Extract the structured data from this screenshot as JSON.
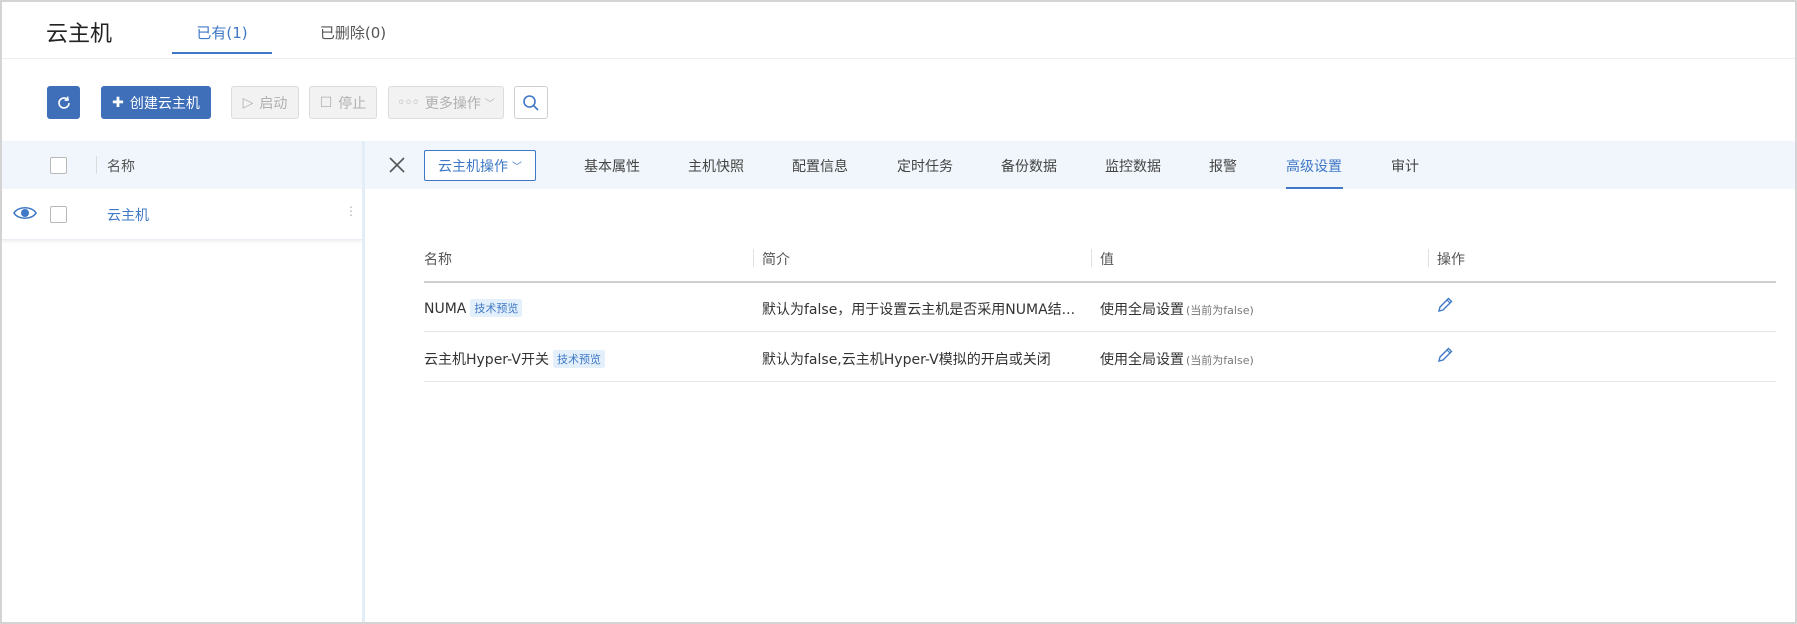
{
  "header": {
    "title": "云主机",
    "tabs": [
      {
        "label": "已有(1)",
        "active": true
      },
      {
        "label": "已删除(0)",
        "active": false
      }
    ]
  },
  "toolbar": {
    "create_label": "创建云主机",
    "start_label": "启动",
    "stop_label": "停止",
    "more_label": "更多操作"
  },
  "list": {
    "column_name": "名称",
    "rows": [
      {
        "name": "云主机"
      }
    ]
  },
  "detail": {
    "vm_ops_label": "云主机操作",
    "tabs": [
      {
        "label": "基本属性"
      },
      {
        "label": "主机快照"
      },
      {
        "label": "配置信息"
      },
      {
        "label": "定时任务"
      },
      {
        "label": "备份数据"
      },
      {
        "label": "监控数据"
      },
      {
        "label": "报警"
      },
      {
        "label": "高级设置",
        "active": true
      },
      {
        "label": "审计"
      }
    ]
  },
  "settings": {
    "headers": [
      "名称",
      "简介",
      "值",
      "操作"
    ],
    "rows": [
      {
        "name": "NUMA",
        "badge": "技术预览",
        "desc": "默认为false，用于设置云主机是否采用NUMA结...",
        "value": "使用全局设置",
        "value_note": "(当前为false)"
      },
      {
        "name": "云主机Hyper-V开关",
        "badge": "技术预览",
        "desc": "默认为false,云主机Hyper-V模拟的开启或关闭",
        "value": "使用全局设置",
        "value_note": "(当前为false)"
      }
    ]
  },
  "colors": {
    "accent": "#3f78c6",
    "primary_button": "#3f6fb8",
    "header_band": "#f0f6fb"
  }
}
